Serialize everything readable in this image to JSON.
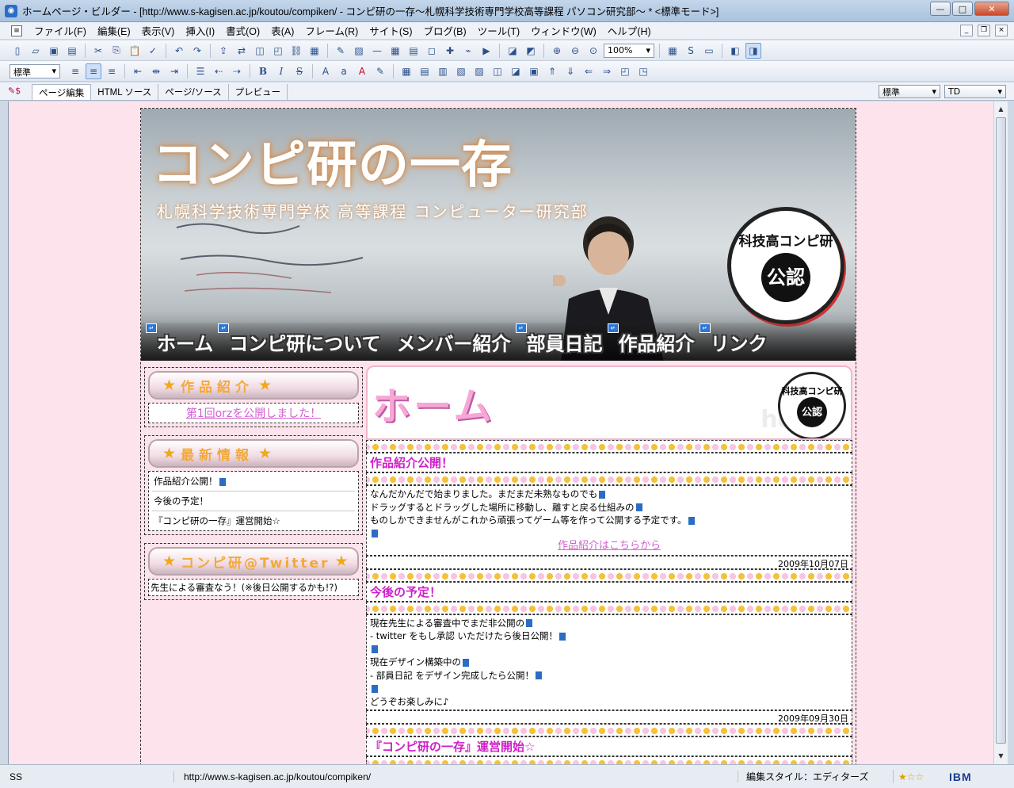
{
  "window": {
    "title": "ホームページ・ビルダー - [http://www.s-kagisen.ac.jp/koutou/compiken/ - コンピ研の一存～札幌科学技術専門学校高等課程 パソコン研究部～ * <標準モード>]",
    "minimize": "—",
    "maximize": "□",
    "close": "✕"
  },
  "menu": {
    "items": [
      "ファイル(F)",
      "編集(E)",
      "表示(V)",
      "挿入(I)",
      "書式(O)",
      "表(A)",
      "フレーム(R)",
      "サイト(S)",
      "ブログ(B)",
      "ツール(T)",
      "ウィンドウ(W)",
      "ヘルプ(H)"
    ]
  },
  "toolbar": {
    "zoom": "100%",
    "style_select": "標準"
  },
  "tabs": {
    "items": [
      "ページ編集",
      "HTML ソース",
      "ページ/ソース",
      "プレビュー"
    ],
    "style_select": "標準",
    "tag_select": "TD"
  },
  "page": {
    "banner": {
      "title": "コンピ研の一存",
      "subtitle": "札幌科学技術専門学校 高等課程 コンピューター研究部",
      "stamp_ring": "科技高コンピ研",
      "stamp_core": "公認"
    },
    "nav": [
      "ホーム",
      "コンピ研について",
      "メンバー紹介",
      "部員日記",
      "作品紹介",
      "リンク"
    ],
    "sidebar": {
      "works": {
        "heading": "作品紹介",
        "link": "第1回orzを公開しました！"
      },
      "news": {
        "heading": "最新情報",
        "items": [
          "作品紹介公開！",
          "今後の予定！",
          "『コンピ研の一存』運営開始☆"
        ]
      },
      "twitter": {
        "heading": "コンピ研@Twitter",
        "text": "先生による審査なう！(※後日公開するかも!?)"
      }
    },
    "main": {
      "page_title": "ホーム",
      "watermark": "home",
      "stamp_ring": "科技高コンピ研",
      "stamp_core": "公認",
      "entries": [
        {
          "title": "作品紹介公開！",
          "lines": [
            "なんだかんだで始まりました。まだまだ未熟なものでも",
            "ドラッグするとドラッグした場所に移動し、離すと戻る仕組みの",
            "ものしかできませんがこれから頑張ってゲーム等を作って公開する予定です。",
            ""
          ],
          "link": "作品紹介はこちらから",
          "date": "2009年10月07日"
        },
        {
          "title": "今後の予定！",
          "lines": [
            "現在先生による審査中でまだ非公開の",
            "- twitter をもし承認 いただけたら後日公開！",
            "",
            "現在デザイン構築中の",
            "- 部員日記 をデザイン完成したら公開！",
            "",
            "どうぞお楽しみに♪"
          ],
          "link": "",
          "date": "2009年09月30日"
        },
        {
          "title": "『コンピ研の一存』運営開始☆",
          "lines": [],
          "link": "",
          "date": ""
        }
      ]
    }
  },
  "status": {
    "left": "SS",
    "url": "http://www.s-kagisen.ac.jp/koutou/compiken/",
    "style": "編集スタイル：エディターズ",
    "rating": "★☆☆",
    "brand": "IBM"
  }
}
